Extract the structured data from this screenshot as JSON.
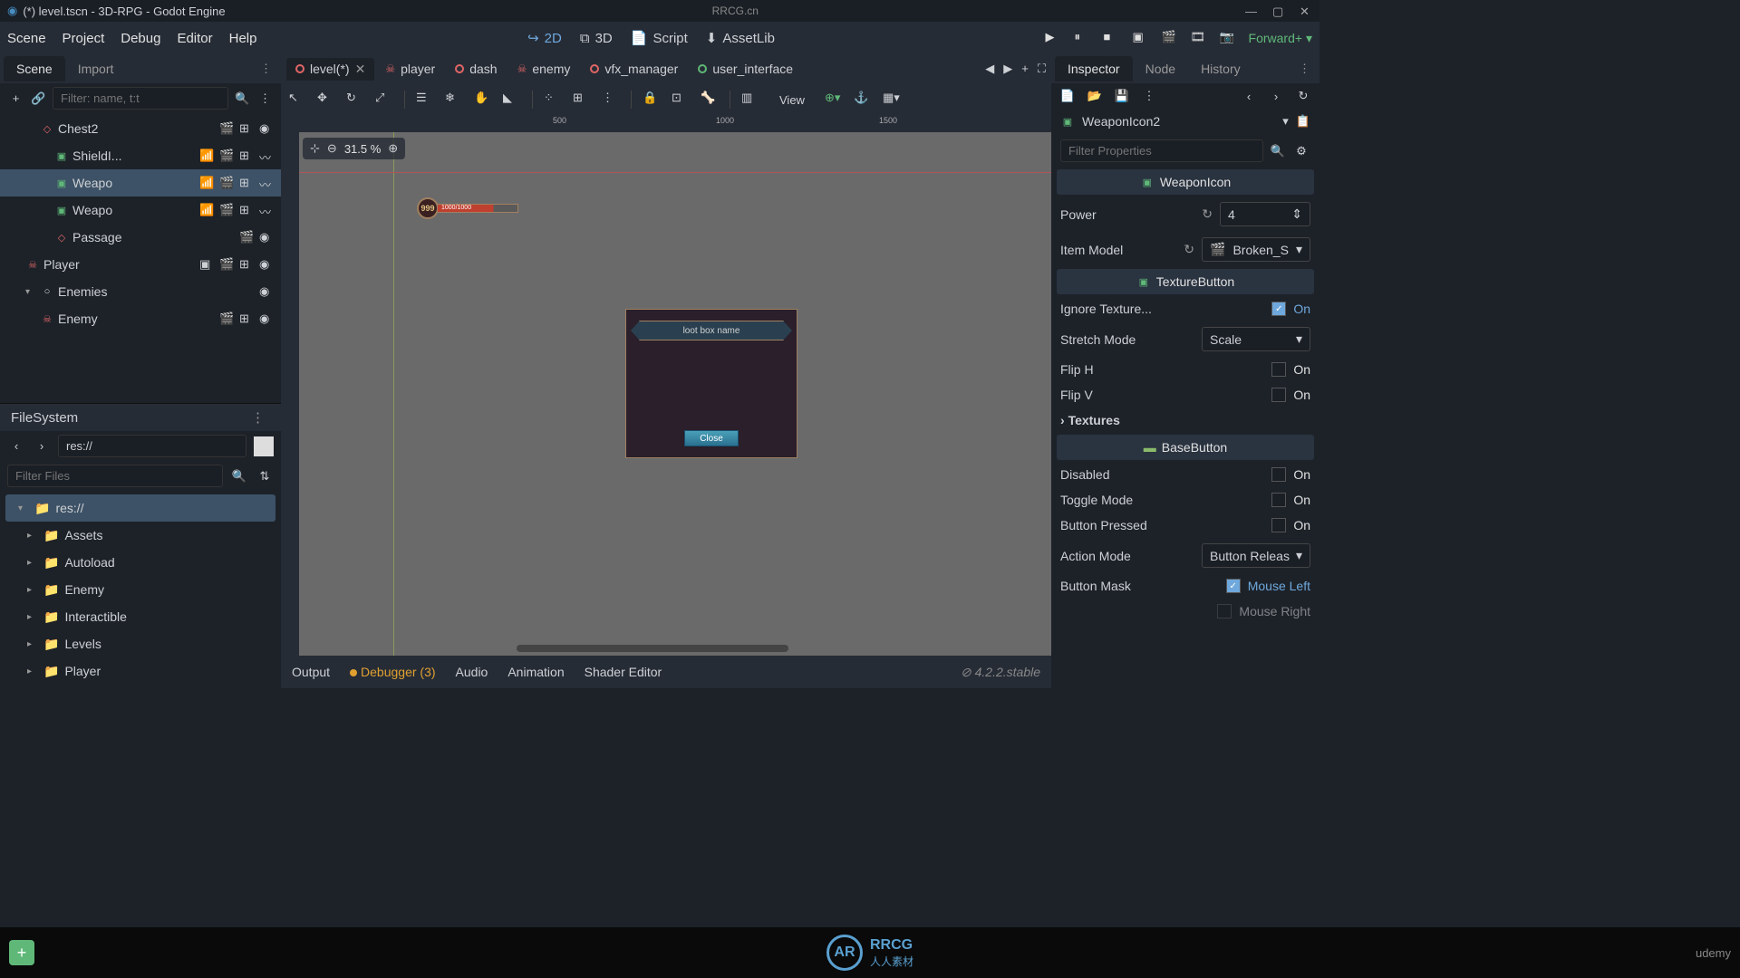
{
  "titlebar": {
    "title": "(*) level.tscn - 3D-RPG - Godot Engine",
    "center": "RRCG.cn"
  },
  "menubar": {
    "items": [
      "Scene",
      "Project",
      "Debug",
      "Editor",
      "Help"
    ],
    "modes": {
      "d2": "2D",
      "d3": "3D",
      "script": "Script",
      "assetlib": "AssetLib"
    },
    "renderer": "Forward+"
  },
  "scene_dock": {
    "tabs": [
      "Scene",
      "Import"
    ],
    "filter_placeholder": "Filter: name, t:t",
    "tree": [
      {
        "name": "Chest2",
        "indent": 2,
        "icon": "red",
        "icons": [
          "clap",
          "grid",
          "eye"
        ]
      },
      {
        "name": "ShieldI...",
        "indent": 3,
        "icon": "green",
        "icons": [
          "wifi",
          "clap",
          "grid",
          "wave"
        ]
      },
      {
        "name": "Weapo",
        "indent": 3,
        "icon": "green",
        "selected": true,
        "icons": [
          "wifi",
          "clap",
          "grid",
          "wave"
        ]
      },
      {
        "name": "Weapo",
        "indent": 3,
        "icon": "green",
        "icons": [
          "wifi",
          "clap",
          "grid",
          "wave"
        ]
      },
      {
        "name": "Passage",
        "indent": 3,
        "icon": "red",
        "icons": [
          "clap",
          "eye"
        ]
      },
      {
        "name": "Player",
        "indent": 1,
        "icon": "skel",
        "icons": [
          "sq",
          "clap",
          "grid",
          "eye"
        ]
      },
      {
        "name": "Enemies",
        "indent": 1,
        "icon": "white",
        "toggle": true,
        "icons": [
          "eye"
        ]
      },
      {
        "name": "Enemy",
        "indent": 2,
        "icon": "skel",
        "icons": [
          "clap",
          "grid",
          "eye"
        ]
      }
    ]
  },
  "filesystem": {
    "title": "FileSystem",
    "path": "res://",
    "filter_placeholder": "Filter Files",
    "tree": [
      {
        "name": "res://",
        "indent": 0,
        "selected": true,
        "open": true
      },
      {
        "name": "Assets",
        "indent": 1
      },
      {
        "name": "Autoload",
        "indent": 1
      },
      {
        "name": "Enemy",
        "indent": 1
      },
      {
        "name": "Interactible",
        "indent": 1
      },
      {
        "name": "Levels",
        "indent": 1
      },
      {
        "name": "Player",
        "indent": 1
      }
    ]
  },
  "scene_tabs": [
    {
      "label": "level(*)",
      "dot": "red",
      "active": true,
      "close": true
    },
    {
      "label": "player",
      "skel": true
    },
    {
      "label": "dash",
      "dot": "red"
    },
    {
      "label": "enemy",
      "skel": true
    },
    {
      "label": "vfx_manager",
      "dot": "red"
    },
    {
      "label": "user_interface",
      "dot": "green"
    }
  ],
  "viewport": {
    "zoom": "31.5 %",
    "view_label": "View",
    "hp_level": "999",
    "hp_text": "1000/1000",
    "loot_title": "loot box name",
    "loot_close": "Close",
    "ruler_marks": [
      "500",
      "1000",
      "1500"
    ]
  },
  "bottom": {
    "tabs": {
      "output": "Output",
      "debugger": "Debugger (3)",
      "audio": "Audio",
      "animation": "Animation",
      "shader": "Shader Editor"
    },
    "version": "4.2.2.stable"
  },
  "inspector": {
    "tabs": [
      "Inspector",
      "Node",
      "History"
    ],
    "node_name": "WeaponIcon2",
    "filter_placeholder": "Filter Properties",
    "sections": {
      "weapon_icon": "WeaponIcon",
      "texture_button": "TextureButton",
      "base_button": "BaseButton",
      "textures": "Textures"
    },
    "props": {
      "power": {
        "label": "Power",
        "value": "4"
      },
      "item_model": {
        "label": "Item Model",
        "value": "Broken_S"
      },
      "ignore_texture": {
        "label": "Ignore Texture...",
        "value": "On",
        "checked": true
      },
      "stretch_mode": {
        "label": "Stretch Mode",
        "value": "Scale"
      },
      "flip_h": {
        "label": "Flip H",
        "value": "On"
      },
      "flip_v": {
        "label": "Flip V",
        "value": "On"
      },
      "disabled": {
        "label": "Disabled",
        "value": "On"
      },
      "toggle_mode": {
        "label": "Toggle Mode",
        "value": "On"
      },
      "button_pressed": {
        "label": "Button Pressed",
        "value": "On"
      },
      "action_mode": {
        "label": "Action Mode",
        "value": "Button Releas"
      },
      "button_mask": {
        "label": "Button Mask",
        "value": "Mouse Left",
        "checked": true
      },
      "mouse_right": {
        "value": "Mouse Right"
      }
    }
  },
  "watermark": {
    "brand": "RRCG",
    "sub": "人人素材",
    "udemy": "udemy"
  }
}
